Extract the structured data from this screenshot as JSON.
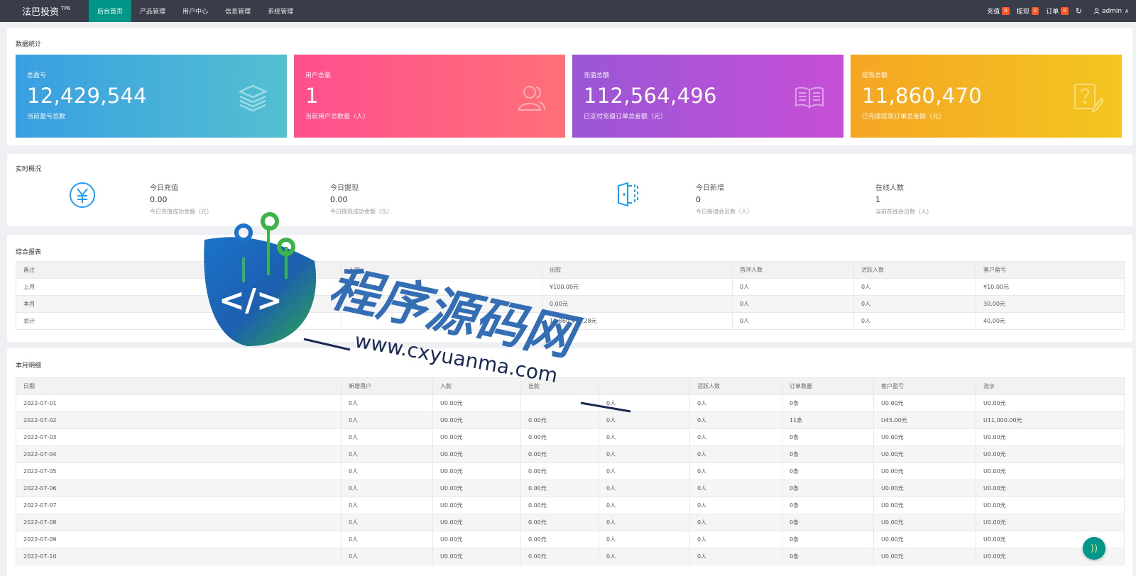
{
  "header": {
    "brand": "法巴投资",
    "brand_sup": "TP6",
    "nav": [
      "后台首页",
      "产品管理",
      "用户中心",
      "信息管理",
      "系统管理"
    ],
    "right": [
      {
        "label": "充值",
        "count": "0"
      },
      {
        "label": "提现",
        "count": "0"
      },
      {
        "label": "订单",
        "count": "0"
      }
    ],
    "refresh_icon": "refresh-icon",
    "user": "admin",
    "colors": {
      "bar": "#393d49",
      "active": "#009688",
      "badge": "#ff5722"
    }
  },
  "stats": {
    "title": "数据统计",
    "tiles": [
      {
        "label": "总盈亏",
        "value": "12,429,544",
        "sub": "当前盈亏总数",
        "icon": "layers-icon"
      },
      {
        "label": "用户总量",
        "value": "1",
        "sub": "当前用户总数量（人）",
        "icon": "users-icon"
      },
      {
        "label": "充值总额",
        "value": "112,564,496",
        "sub": "已支付充值订单总金额（元）",
        "icon": "book-icon"
      },
      {
        "label": "提现总额",
        "value": "11,860,470",
        "sub": "已完成提现订单总金额（元）",
        "icon": "edit-question-icon"
      }
    ]
  },
  "realtime": {
    "title": "实时概况",
    "items": [
      {
        "label": "今日充值",
        "value": "0.00",
        "sub": "今日充值成功金额（元）"
      },
      {
        "label": "今日提现",
        "value": "0.00",
        "sub": "今日提现成功金额（元）"
      },
      {
        "label": "今日新增",
        "value": "0",
        "sub": "今日新增会员数（人）"
      },
      {
        "label": "在线人数",
        "value": "1",
        "sub": "当前在线会员数（人）"
      }
    ]
  },
  "report": {
    "title": "综合报表",
    "columns": [
      "备注",
      "入款",
      "出款",
      "首冲人数",
      "活跃人数",
      "客户盈亏"
    ],
    "rows": [
      [
        "上月",
        "",
        "¥100.00元",
        "0人",
        "0人",
        "¥10.00元"
      ],
      [
        "本月",
        "",
        "0.00元",
        "0人",
        "0人",
        "30.00元"
      ],
      [
        "总计",
        "",
        "11,860,470.28元",
        "0人",
        "0人",
        "40.00元"
      ]
    ]
  },
  "monthly": {
    "title": "本月明细",
    "columns": [
      "日期",
      "新增用户",
      "入款",
      "出款",
      "",
      "活跃人数",
      "订单数量",
      "客户盈亏",
      "流水"
    ],
    "rows": [
      [
        "2022-07-01",
        "0人",
        "U0.00元",
        "",
        "0人",
        "0人",
        "0条",
        "U0.00元",
        "U0.00元"
      ],
      [
        "2022-07-02",
        "0人",
        "U0.00元",
        "0.00元",
        "0人",
        "0人",
        "11条",
        "U45.00元",
        "U11,000.00元"
      ],
      [
        "2022-07-03",
        "0人",
        "U0.00元",
        "0.00元",
        "0人",
        "0人",
        "0条",
        "U0.00元",
        "U0.00元"
      ],
      [
        "2022-07-04",
        "0人",
        "U0.00元",
        "0.00元",
        "0人",
        "0人",
        "0条",
        "U0.00元",
        "U0.00元"
      ],
      [
        "2022-07-05",
        "0人",
        "U0.00元",
        "0.00元",
        "0人",
        "0人",
        "0条",
        "U0.00元",
        "U0.00元"
      ],
      [
        "2022-07-06",
        "0人",
        "U0.00元",
        "0.00元",
        "0人",
        "0人",
        "0条",
        "U0.00元",
        "U0.00元"
      ],
      [
        "2022-07-07",
        "0人",
        "U0.00元",
        "0.00元",
        "0人",
        "0人",
        "0条",
        "U0.00元",
        "U0.00元"
      ],
      [
        "2022-07-08",
        "0人",
        "U0.00元",
        "0.00元",
        "0人",
        "0人",
        "0条",
        "U0.00元",
        "U0.00元"
      ],
      [
        "2022-07-09",
        "0人",
        "U0.00元",
        "0.00元",
        "0人",
        "0人",
        "0条",
        "U0.00元",
        "U0.00元"
      ],
      [
        "2022-07-10",
        "0人",
        "U0.00元",
        "0.00元",
        "0人",
        "0人",
        "0条",
        "U0.00元",
        "U0.00元"
      ]
    ]
  },
  "watermark": {
    "text": "程序源码网",
    "url": "www.cxyuanma.com"
  },
  "float_button_icon": "sound-icon"
}
